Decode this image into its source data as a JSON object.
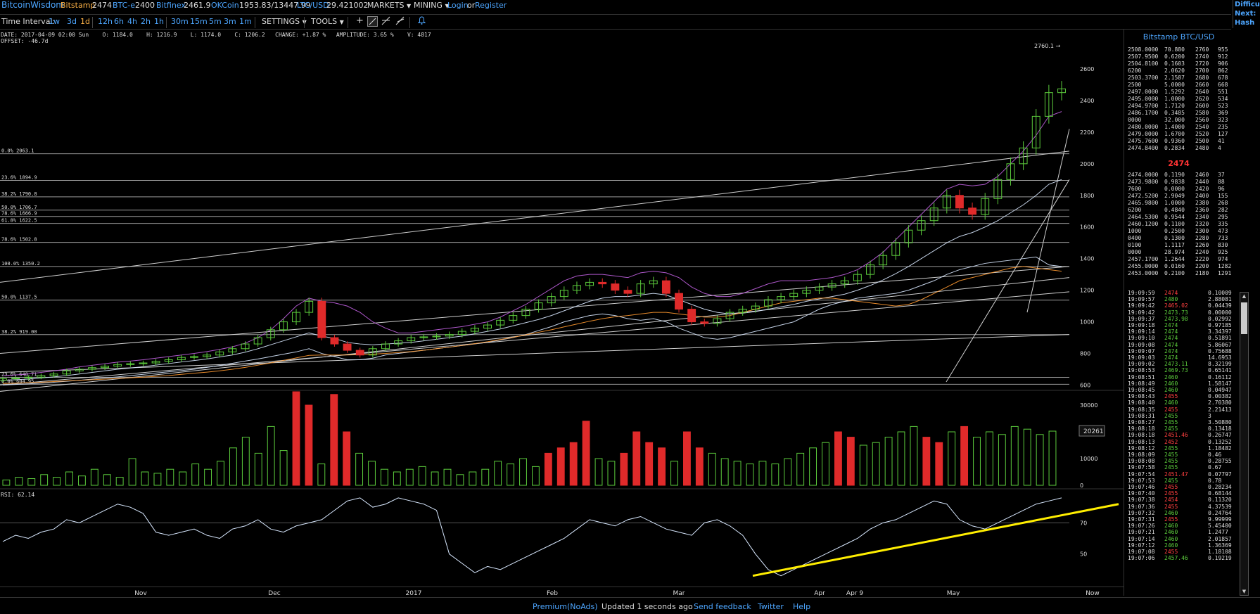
{
  "topbar": {
    "brand": "BitcoinWisdom",
    "exchanges": [
      {
        "name": "Bitstamp",
        "price": "2474",
        "style": "ex"
      },
      {
        "name": "BTC-e",
        "price": "2400",
        "style": "exb"
      },
      {
        "name": "Bitfinex",
        "price": "2461.9",
        "style": "exb"
      },
      {
        "name": "OKCoin",
        "price": "1953.83/13447.99",
        "style": "exb"
      },
      {
        "name": "LTC/USD",
        "price": "29.421002",
        "style": "exb"
      }
    ],
    "markets": "MARKETS",
    "mining": "MINING",
    "login": "Login",
    "or": "or",
    "register": "Register",
    "right_cut_1": "Difficu",
    "right_cut_2": "Next:",
    "right_cut_3": "Hash Ra"
  },
  "toolbar": {
    "time_interval_label": "Time Interval:",
    "intervals": [
      "1w",
      "3d",
      "1d",
      "12h",
      "6h",
      "4h",
      "2h",
      "1h",
      "30m",
      "15m",
      "5m",
      "3m",
      "1m"
    ],
    "settings": "SETTINGS",
    "tools": "TOOLS"
  },
  "info": {
    "line1": "DATE: 2017-04-09 02:00 Sun    O: 1184.0    H: 1216.9    L: 1174.0    C: 1206.2   CHANGE: +1.87 %   AMPLITUDE: 3.65 %    V: 4817",
    "line2": "OFFSET: -46.7d"
  },
  "chart_data": {
    "type": "line",
    "title": "",
    "x_ticks": [
      "Nov",
      "Dec",
      "2017",
      "Feb",
      "Mar",
      "Apr",
      "Apr 9",
      "May",
      "Now"
    ],
    "price_axis": [
      "2600",
      "2400",
      "2200",
      "2000",
      "1800",
      "1600",
      "1400",
      "1200",
      "1000",
      "800",
      "600"
    ],
    "price_ylim": [
      580,
      2760
    ],
    "high_label": "2760.1",
    "fib_levels": [
      {
        "label": "0.0% 2063.1",
        "value": 2063.1
      },
      {
        "label": "23.6% 1894.9",
        "value": 1894.9
      },
      {
        "label": "38.2% 1790.8",
        "value": 1790.8
      },
      {
        "label": "50.0% 1706.7",
        "value": 1706.7
      },
      {
        "label": "78.6% 1666.9",
        "value": 1666.9
      },
      {
        "label": "61.8% 1622.5",
        "value": 1622.5
      },
      {
        "label": "78.6% 1502.8",
        "value": 1502.8
      },
      {
        "label": "100.0% 1350.2",
        "value": 1350.2
      },
      {
        "label": "50.0% 1137.5",
        "value": 1137.5
      },
      {
        "label": "38.2% 919.00",
        "value": 919.0
      },
      {
        "label": "23.6% 648.71",
        "value": 648.71
      },
      {
        "label": "0.0% 604.95",
        "value": 604.95
      }
    ],
    "price_series": [
      {
        "name": "close",
        "values": [
          640,
          645,
          650,
          660,
          670,
          690,
          700,
          710,
          720,
          730,
          735,
          740,
          750,
          760,
          775,
          780,
          790,
          810,
          830,
          860,
          900,
          950,
          1000,
          1060,
          1130,
          900,
          860,
          820,
          790,
          830,
          860,
          880,
          900,
          905,
          910,
          920,
          940,
          960,
          980,
          1010,
          1040,
          1080,
          1120,
          1160,
          1200,
          1230,
          1250,
          1240,
          1200,
          1180,
          1240,
          1260,
          1180,
          1080,
          1000,
          990,
          1020,
          1060,
          1080,
          1100,
          1140,
          1160,
          1180,
          1200,
          1220,
          1240,
          1260,
          1300,
          1360,
          1420,
          1500,
          1580,
          1640,
          1720,
          1800,
          1720,
          1680,
          1780,
          1900,
          2000,
          2100,
          2300,
          2450,
          2474
        ]
      },
      {
        "name": "ma_white",
        "values": [
          630,
          634,
          638,
          645,
          652,
          660,
          670,
          680,
          690,
          700,
          708,
          716,
          726,
          736,
          746,
          755,
          765,
          778,
          790,
          808,
          830,
          855,
          880,
          905,
          930,
          910,
          895,
          870,
          860,
          855,
          860,
          865,
          870,
          880,
          890,
          900,
          910,
          925,
          940,
          955,
          975,
          995,
          1015,
          1040,
          1070,
          1100,
          1130,
          1150,
          1160,
          1160,
          1170,
          1180,
          1170,
          1140,
          1110,
          1080,
          1060,
          1050,
          1055,
          1065,
          1080,
          1095,
          1110,
          1130,
          1145,
          1160,
          1175,
          1200,
          1230,
          1265,
          1305,
          1350,
          1400,
          1450,
          1500,
          1540,
          1565,
          1600,
          1640,
          1690,
          1740,
          1800,
          1870,
          1900
        ]
      },
      {
        "name": "bb_upper",
        "values": [
          660,
          664,
          670,
          680,
          690,
          700,
          715,
          725,
          735,
          745,
          752,
          760,
          770,
          780,
          790,
          800,
          812,
          826,
          842,
          865,
          900,
          950,
          1020,
          1100,
          1150,
          1130,
          1120,
          1100,
          1060,
          1000,
          960,
          930,
          930,
          940,
          950,
          960,
          970,
          985,
          1000,
          1030,
          1070,
          1110,
          1160,
          1210,
          1260,
          1290,
          1300,
          1300,
          1290,
          1280,
          1310,
          1320,
          1310,
          1280,
          1220,
          1180,
          1160,
          1160,
          1180,
          1210,
          1240,
          1260,
          1260,
          1260,
          1270,
          1280,
          1300,
          1330,
          1380,
          1440,
          1520,
          1600,
          1680,
          1760,
          1840,
          1870,
          1860,
          1870,
          1920,
          2000,
          2080,
          2180,
          2300,
          2330
        ]
      },
      {
        "name": "bb_lower",
        "values": [
          600,
          604,
          608,
          612,
          618,
          624,
          630,
          638,
          645,
          652,
          660,
          668,
          676,
          684,
          692,
          700,
          712,
          724,
          738,
          752,
          765,
          780,
          795,
          810,
          830,
          800,
          780,
          760,
          760,
          770,
          790,
          800,
          810,
          820,
          830,
          840,
          850,
          860,
          870,
          885,
          900,
          920,
          945,
          970,
          1000,
          1020,
          1040,
          1050,
          1040,
          1020,
          1010,
          1020,
          1000,
          960,
          930,
          900,
          890,
          900,
          920,
          940,
          960,
          980,
          1000,
          1040,
          1080,
          1110,
          1130,
          1150,
          1160,
          1170,
          1180,
          1200,
          1230,
          1260,
          1300,
          1330,
          1350,
          1370,
          1380,
          1390,
          1400,
          1410,
          1360,
          1350
        ]
      },
      {
        "name": "ma_orange",
        "values": [
          610,
          612,
          615,
          618,
          622,
          626,
          630,
          634,
          638,
          642,
          646,
          650,
          655,
          660,
          668,
          675,
          682,
          690,
          700,
          712,
          726,
          740,
          756,
          772,
          788,
          790,
          790,
          790,
          792,
          796,
          800,
          806,
          812,
          820,
          830,
          840,
          850,
          862,
          874,
          888,
          902,
          918,
          934,
          950,
          968,
          986,
          1004,
          1020,
          1032,
          1040,
          1050,
          1060,
          1060,
          1050,
          1040,
          1030,
          1030,
          1040,
          1060,
          1080,
          1100,
          1120,
          1130,
          1140,
          1150,
          1150,
          1140,
          1130,
          1120,
          1110,
          1100,
          1110,
          1140,
          1180,
          1220,
          1260,
          1280,
          1300,
          1320,
          1340,
          1350,
          1340,
          1330,
          1320
        ]
      }
    ],
    "volume_axis": [
      "30000",
      "20000",
      "10000",
      "0"
    ],
    "volume_ylim": [
      0,
      35000
    ],
    "volume_label": "20261",
    "volume_values": [
      2000,
      3000,
      2500,
      4000,
      3000,
      5000,
      3500,
      6000,
      4000,
      3000,
      10000,
      5000,
      4500,
      6000,
      5000,
      8000,
      6000,
      9000,
      14000,
      18000,
      12000,
      22000,
      13000,
      35000,
      30000,
      8000,
      34000,
      20000,
      12000,
      9000,
      6000,
      5000,
      6000,
      7000,
      5000,
      6000,
      4000,
      5000,
      6000,
      9000,
      8000,
      10000,
      7000,
      12000,
      14000,
      16000,
      24000,
      10000,
      9000,
      12000,
      20000,
      16000,
      14000,
      9000,
      20000,
      14000,
      12000,
      10000,
      9000,
      8000,
      9000,
      8000,
      10000,
      12000,
      14000,
      16000,
      20000,
      18000,
      15000,
      16000,
      18000,
      20000,
      22000,
      18000,
      16000,
      20000,
      22000,
      18000,
      20000,
      19000,
      22000,
      21000,
      19000,
      20261
    ],
    "volume_down": [
      false,
      false,
      false,
      false,
      false,
      false,
      false,
      false,
      false,
      false,
      false,
      false,
      false,
      false,
      false,
      false,
      false,
      false,
      false,
      false,
      false,
      false,
      false,
      true,
      true,
      false,
      true,
      true,
      false,
      false,
      false,
      false,
      false,
      false,
      false,
      false,
      false,
      false,
      false,
      false,
      false,
      false,
      false,
      true,
      true,
      true,
      true,
      false,
      false,
      true,
      true,
      true,
      true,
      false,
      true,
      true,
      false,
      false,
      false,
      false,
      false,
      false,
      false,
      false,
      false,
      false,
      true,
      true,
      false,
      false,
      false,
      false,
      false,
      true,
      true,
      false,
      true,
      false,
      false,
      false,
      false,
      false,
      false,
      false
    ],
    "rsi_label": "RSI: 62.14",
    "rsi_axis": [
      "70",
      "50"
    ],
    "rsi_ylim": [
      30,
      90
    ],
    "rsi_values": [
      58,
      62,
      60,
      64,
      66,
      72,
      70,
      74,
      78,
      82,
      80,
      76,
      64,
      62,
      64,
      66,
      62,
      60,
      66,
      68,
      72,
      66,
      64,
      68,
      70,
      72,
      78,
      84,
      86,
      80,
      82,
      86,
      84,
      82,
      78,
      50,
      44,
      38,
      42,
      40,
      44,
      48,
      52,
      56,
      60,
      66,
      72,
      70,
      68,
      72,
      74,
      70,
      66,
      64,
      62,
      70,
      72,
      68,
      62,
      50,
      40,
      36,
      40,
      44,
      48,
      52,
      56,
      60,
      66,
      70,
      72,
      76,
      80,
      84,
      82,
      72,
      68,
      66,
      70,
      74,
      78,
      82,
      84,
      86
    ],
    "rsi_trendline": [
      {
        "x": "Mar",
        "y": 36
      },
      {
        "x": "Now",
        "y": 82
      }
    ],
    "colors": {
      "up": "#5ccc3c",
      "down": "#e02a2a",
      "ma_white": "#d8e8ff",
      "ma_violet": "#c060e0",
      "ma_orange": "#ff9930",
      "trend": "#ffee00",
      "grid": "#7a7a7a"
    }
  },
  "orderbook": {
    "title": "Bitstamp BTC/USD",
    "asks": [
      [
        "2508.0000",
        "70.880",
        "2760",
        "955"
      ],
      [
        "2507.9500",
        "0.6200",
        "2740",
        "912"
      ],
      [
        "2504.8100",
        "0.1603",
        "2720",
        "906"
      ],
      [
        "6200",
        "2.0620",
        "2700",
        "862"
      ],
      [
        "2503.3700",
        "2.1587",
        "2680",
        "678"
      ],
      [
        "2500",
        "5.0000",
        "2660",
        "668"
      ],
      [
        "2497.0000",
        "1.5292",
        "2640",
        "551"
      ],
      [
        "2495.0000",
        "1.0000",
        "2620",
        "534"
      ],
      [
        "2494.9700",
        "1.7120",
        "2600",
        "523"
      ],
      [
        "2486.1700",
        "0.3485",
        "2580",
        "369"
      ],
      [
        "0000",
        "32.000",
        "2560",
        "323"
      ],
      [
        "2480.0000",
        "1.4000",
        "2540",
        "235"
      ],
      [
        "2479.0000",
        "1.6700",
        "2520",
        "127"
      ],
      [
        "2475.7600",
        "0.9360",
        "2500",
        "41"
      ],
      [
        "2474.8400",
        "0.2834",
        "2480",
        "4"
      ]
    ],
    "last": "2474",
    "bids": [
      [
        "2474.0000",
        "0.1190",
        "2460",
        "37"
      ],
      [
        "2473.9800",
        "0.9838",
        "2440",
        "88"
      ],
      [
        "7600",
        "0.0000",
        "2420",
        "96"
      ],
      [
        "2472.5200",
        "2.9049",
        "2400",
        "155"
      ],
      [
        "2465.9800",
        "1.0000",
        "2380",
        "268"
      ],
      [
        "6200",
        "0.4840",
        "2360",
        "282"
      ],
      [
        "2464.5300",
        "0.9544",
        "2340",
        "295"
      ],
      [
        "2460.1200",
        "0.1100",
        "2320",
        "335"
      ],
      [
        "1000",
        "0.2500",
        "2300",
        "473"
      ],
      [
        "0400",
        "0.1300",
        "2280",
        "733"
      ],
      [
        "0100",
        "1.1117",
        "2260",
        "830"
      ],
      [
        "0000",
        "28.974",
        "2240",
        "925"
      ],
      [
        "2457.1700",
        "1.2644",
        "2220",
        "974"
      ],
      [
        "2455.0000",
        "0.0160",
        "2200",
        "1282"
      ],
      [
        "2453.0000",
        "0.2100",
        "2180",
        "1291"
      ]
    ],
    "trades": [
      [
        "19:09:59",
        "2474",
        "0.10009",
        "down"
      ],
      [
        "19:09:57",
        "2480",
        "2.88081",
        "up"
      ],
      [
        "19:09:42",
        "2465.02",
        "0.04439",
        "down"
      ],
      [
        "19:09:42",
        "2473.73",
        "0.00000",
        "up"
      ],
      [
        "19:09:37",
        "2473.98",
        "0.02992",
        "up"
      ],
      [
        "19:09:18",
        "2474",
        "0.97185",
        "up"
      ],
      [
        "19:09:14",
        "2474",
        "3.34397",
        "up"
      ],
      [
        "19:09:10",
        "2474",
        "0.51891",
        "up"
      ],
      [
        "19:09:08",
        "2474",
        "5.86067",
        "up"
      ],
      [
        "19:09:07",
        "2474",
        "0.75688",
        "up"
      ],
      [
        "19:09:03",
        "2474",
        "14.6953",
        "up"
      ],
      [
        "19:09:02",
        "2473.11",
        "8.32199",
        "up"
      ],
      [
        "19:08:53",
        "2469.73",
        "0.65141",
        "up"
      ],
      [
        "19:08:51",
        "2460",
        "0.16112",
        "up"
      ],
      [
        "19:08:49",
        "2460",
        "1.58147",
        "up"
      ],
      [
        "19:08:45",
        "2460",
        "0.04947",
        "up"
      ],
      [
        "19:08:43",
        "2455",
        "0.00382",
        "down"
      ],
      [
        "19:08:40",
        "2460",
        "2.70380",
        "up"
      ],
      [
        "19:08:35",
        "2455",
        "2.21413",
        "down"
      ],
      [
        "19:08:31",
        "2455",
        "3",
        "up"
      ],
      [
        "19:08:27",
        "2455",
        "3.50880",
        "up"
      ],
      [
        "19:08:18",
        "2455",
        "0.13418",
        "up"
      ],
      [
        "19:08:18",
        "2451.46",
        "0.26747",
        "down"
      ],
      [
        "19:08:13",
        "2452",
        "0.13252",
        "down"
      ],
      [
        "19:08:12",
        "2455",
        "1.18482",
        "up"
      ],
      [
        "19:08:09",
        "2455",
        "0.46",
        "up"
      ],
      [
        "19:08:08",
        "2455",
        "0.28755",
        "up"
      ],
      [
        "19:07:58",
        "2455",
        "0.67",
        "up"
      ],
      [
        "19:07:54",
        "2451.47",
        "0.07797",
        "down"
      ],
      [
        "19:07:53",
        "2455",
        "0.78",
        "up"
      ],
      [
        "19:07:46",
        "2455",
        "0.28234",
        "down"
      ],
      [
        "19:07:40",
        "2455",
        "0.68144",
        "down"
      ],
      [
        "19:07:38",
        "2454",
        "0.11320",
        "down"
      ],
      [
        "19:07:36",
        "2455",
        "4.37539",
        "down"
      ],
      [
        "19:07:32",
        "2460",
        "0.24764",
        "up"
      ],
      [
        "19:07:31",
        "2455",
        "9.99999",
        "down"
      ],
      [
        "19:07:26",
        "2460",
        "5.45400",
        "up"
      ],
      [
        "19:07:21",
        "2460",
        "1.2477",
        "up"
      ],
      [
        "19:07:14",
        "2460",
        "2.01857",
        "up"
      ],
      [
        "19:07:12",
        "2460",
        "1.36369",
        "up"
      ],
      [
        "19:07:08",
        "2455",
        "1.18108",
        "down"
      ],
      [
        "19:07:06",
        "2457.46",
        "0.19219",
        "up"
      ]
    ]
  },
  "footer": {
    "premium": "Premium(NoAds)",
    "updated": "Updated 1 seconds ago",
    "feedback": "Send feedback",
    "twitter": "Twitter",
    "help": "Help"
  }
}
